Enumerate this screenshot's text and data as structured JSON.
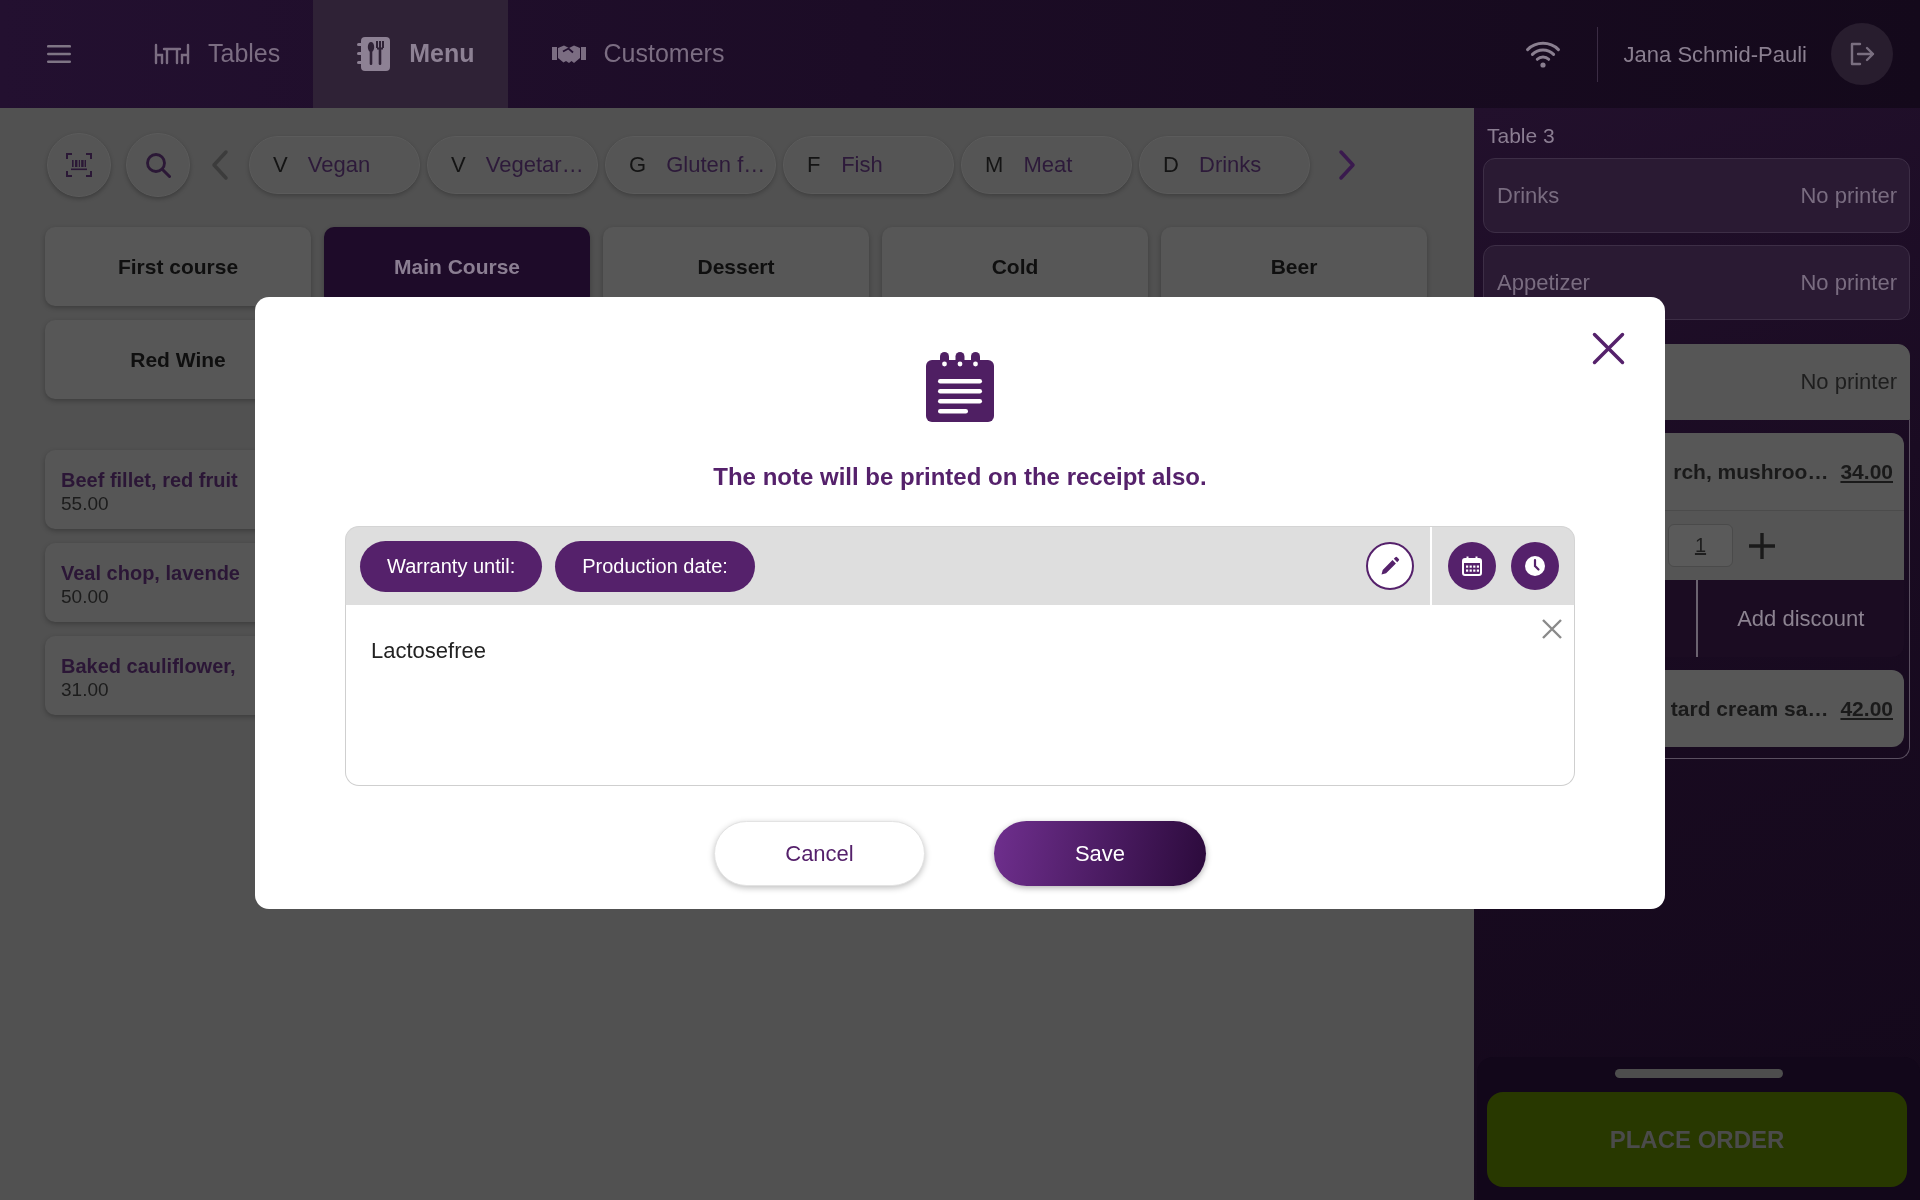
{
  "top_bar": {
    "tabs": [
      {
        "label": "Tables",
        "selected": false
      },
      {
        "label": "Menu",
        "selected": true
      },
      {
        "label": "Customers",
        "selected": false
      }
    ],
    "user_name": "Jana Schmid-Pauli"
  },
  "filter_bar": {
    "scroll_left": {
      "disabled": true
    },
    "chips": [
      {
        "letter": "V",
        "label": "Vegan"
      },
      {
        "letter": "V",
        "label": "Vegetar…"
      },
      {
        "letter": "G",
        "label": "Gluten f…"
      },
      {
        "letter": "F",
        "label": "Fish"
      },
      {
        "letter": "M",
        "label": "Meat"
      },
      {
        "letter": "D",
        "label": "Drinks"
      }
    ],
    "scroll_right": {
      "disabled": false
    }
  },
  "categories": [
    {
      "label": "First course",
      "selected": false
    },
    {
      "label": "Main Course",
      "selected": true
    },
    {
      "label": "Dessert",
      "selected": false
    },
    {
      "label": "Cold",
      "selected": false
    },
    {
      "label": "Beer",
      "selected": false
    },
    {
      "label": "Red Wine",
      "selected": false
    }
  ],
  "menu_items": [
    {
      "name": "Beef fillet, red fruit",
      "price": "55.00"
    },
    {
      "name": "Veal chop, lavende",
      "price": "50.00"
    },
    {
      "name": "Baked cauliflower,",
      "price": "31.00"
    }
  ],
  "order_panel": {
    "title": "Table 3",
    "groups": [
      {
        "name": "Drinks",
        "printer": "No printer",
        "expanded": false
      },
      {
        "name": "Appetizer",
        "printer": "No printer",
        "expanded": false
      },
      {
        "printer": "No printer",
        "expanded": true,
        "items": [
          {
            "name": "rch, mushroo…",
            "price": "34.00",
            "expanded": true,
            "quantity": "1",
            "action": "Add discount"
          },
          {
            "name": "tard cream sa…",
            "price": "42.00",
            "expanded": false
          }
        ]
      }
    ],
    "place_order": "PLACE ORDER"
  },
  "note_dialog": {
    "message": "The note will be printed on the receipt also.",
    "tags": [
      {
        "label": "Warranty until:"
      },
      {
        "label": "Production date:"
      }
    ],
    "note": "Lactosefree",
    "buttons": [
      {
        "label": "Cancel",
        "kind": "secondary"
      },
      {
        "label": "Save",
        "kind": "primary"
      }
    ]
  }
}
